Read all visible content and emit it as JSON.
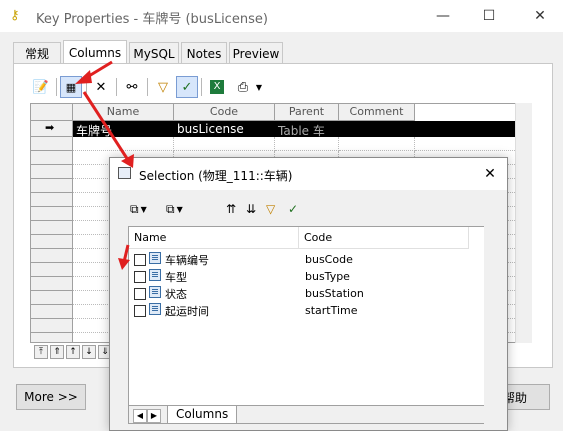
{
  "main_window": {
    "title": "Key Properties - 车牌号 (busLicense)",
    "tabs": [
      {
        "label": "常规"
      },
      {
        "label": "Columns"
      },
      {
        "label": "MySQL"
      },
      {
        "label": "Notes"
      },
      {
        "label": "Preview"
      }
    ],
    "grid": {
      "columns": [
        "Name",
        "Code",
        "Parent",
        "Comment"
      ],
      "rows": [
        {
          "name": "车牌号",
          "code": "busLicense",
          "parent": "Table 车"
        }
      ]
    },
    "buttons": {
      "more": "More >>",
      "help": "帮助"
    }
  },
  "selection_dialog": {
    "title": "Selection (物理_111::车辆)",
    "columns": [
      "Name",
      "Code"
    ],
    "rows": [
      {
        "name": "车辆编号",
        "code": "busCode"
      },
      {
        "name": "车型",
        "code": "busType"
      },
      {
        "name": "状态",
        "code": "busStation"
      },
      {
        "name": "起运时间",
        "code": "startTime"
      }
    ],
    "bottom_tab": "Columns"
  },
  "icons": {
    "title": "key-icon",
    "close": "close-icon",
    "maximize": "maximize-icon",
    "minimize": "minimize-icon"
  },
  "colors": {
    "selected_row": "#000000",
    "annotation_arrow": "#e02020"
  }
}
